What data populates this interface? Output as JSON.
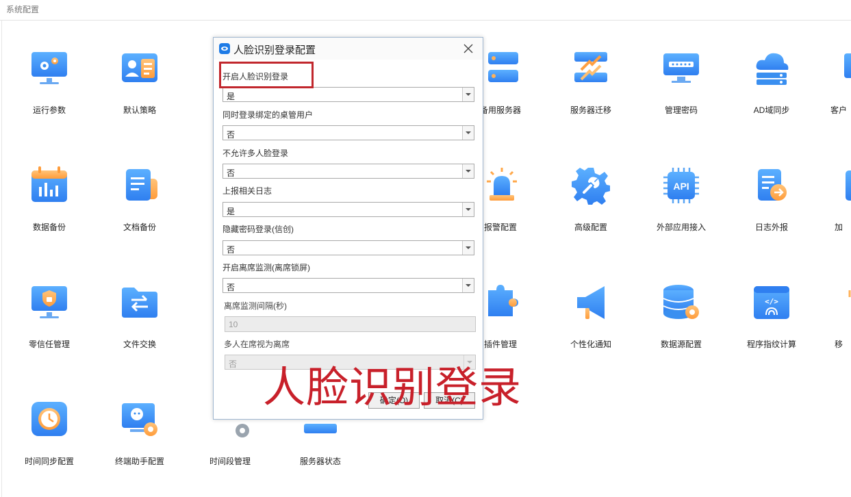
{
  "page": {
    "title": "系统配置"
  },
  "tiles": [
    {
      "label": "运行参数",
      "icon": "monitor-gear-icon"
    },
    {
      "label": "默认策略",
      "icon": "id-card-icon"
    },
    {
      "label": "备用服务器",
      "icon": "server-stack-icon"
    },
    {
      "label": "服务器迁移",
      "icon": "server-migrate-icon"
    },
    {
      "label": "管理密码",
      "icon": "password-box-icon"
    },
    {
      "label": "AD域同步",
      "icon": "cloud-server-icon"
    },
    {
      "label": "客户",
      "icon": "client-icon"
    },
    {
      "label": "数据备份",
      "icon": "calendar-chart-icon"
    },
    {
      "label": "文档备份",
      "icon": "document-icon"
    },
    {
      "label": "报警配置",
      "icon": "alarm-light-icon"
    },
    {
      "label": "高级配置",
      "icon": "gear-wrench-icon"
    },
    {
      "label": "外部应用接入",
      "icon": "api-chip-icon"
    },
    {
      "label": "日志外报",
      "icon": "log-export-icon"
    },
    {
      "label": "加",
      "icon": "add-icon"
    },
    {
      "label": "零信任管理",
      "icon": "shield-lock-icon"
    },
    {
      "label": "文件交换",
      "icon": "folder-exchange-icon"
    },
    {
      "label": "插件管理",
      "icon": "puzzle-icon"
    },
    {
      "label": "个性化通知",
      "icon": "megaphone-icon"
    },
    {
      "label": "数据源配置",
      "icon": "database-gear-icon"
    },
    {
      "label": "程序指纹计算",
      "icon": "code-fingerprint-icon"
    },
    {
      "label": "移",
      "icon": "move-icon"
    },
    {
      "label": "时间同步配置",
      "icon": "clock-icon"
    },
    {
      "label": "终端助手配置",
      "icon": "assistant-gear-icon"
    },
    {
      "label": "时间段管理",
      "icon": "time-segment-icon"
    },
    {
      "label": "服务器状态",
      "icon": "server-status-icon"
    }
  ],
  "dialog": {
    "title": "人脸识别登录配置",
    "fields": [
      {
        "label": "开启人脸识别登录",
        "value": "是"
      },
      {
        "label": "同时登录绑定的桌管用户",
        "value": "否"
      },
      {
        "label": "不允许多人脸登录",
        "value": "否"
      },
      {
        "label": "上报相关日志",
        "value": "是"
      },
      {
        "label": "隐藏密码登录(信创)",
        "value": "否"
      },
      {
        "label": "开启离席监测(离席锁屏)",
        "value": "否"
      },
      {
        "label": "离席监测间隔(秒)",
        "value": "10"
      },
      {
        "label": "多人在席视为离席",
        "value": "否"
      }
    ],
    "ok_label": "确定(O)",
    "cancel_label": "取消(C)"
  },
  "overlay": {
    "text": "人脸识别登录"
  },
  "colors": {
    "accent_blue": "#3a8ff0",
    "annotation_red": "#c8202a"
  }
}
